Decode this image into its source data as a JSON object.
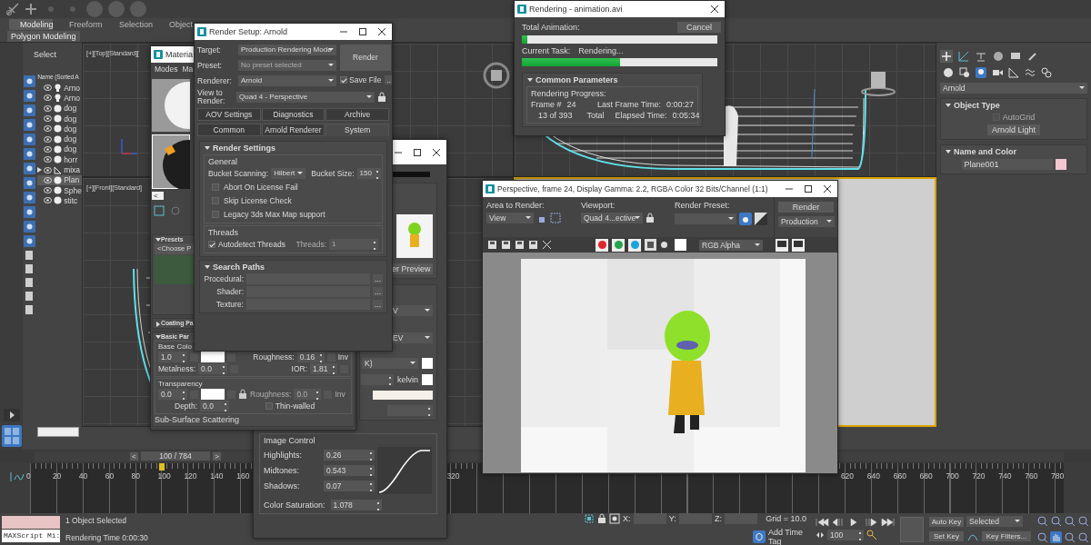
{
  "ribbon": {
    "tabs": [
      {
        "label": "Modeling",
        "selected": true
      },
      {
        "label": "Freeform",
        "selected": false
      },
      {
        "label": "Selection",
        "selected": false
      },
      {
        "label": "Object",
        "selected": false
      }
    ],
    "panel_label": "Polygon Modeling"
  },
  "scene_explorer": {
    "title": "Select",
    "column": "Name (Sorted A",
    "items": [
      {
        "name": "Arno",
        "kind": "light",
        "selected": false,
        "expandable": false
      },
      {
        "name": "Arno",
        "kind": "light",
        "selected": false,
        "expandable": false
      },
      {
        "name": "dog",
        "kind": "geometry",
        "selected": false,
        "expandable": false
      },
      {
        "name": "dog",
        "kind": "geometry",
        "selected": false,
        "expandable": false
      },
      {
        "name": "dog",
        "kind": "geometry",
        "selected": false,
        "expandable": false
      },
      {
        "name": "dog",
        "kind": "geometry",
        "selected": false,
        "expandable": false
      },
      {
        "name": "dog",
        "kind": "geometry",
        "selected": false,
        "expandable": false
      },
      {
        "name": "horr",
        "kind": "geometry",
        "selected": false,
        "expandable": false
      },
      {
        "name": "mixa",
        "kind": "bone",
        "selected": false,
        "expandable": true
      },
      {
        "name": "Plan",
        "kind": "geometry",
        "selected": true,
        "expandable": false
      },
      {
        "name": "Sphe",
        "kind": "geometry",
        "selected": false,
        "expandable": false
      },
      {
        "name": "stitc",
        "kind": "geometry",
        "selected": false,
        "expandable": false
      }
    ]
  },
  "viewports": [
    {
      "label": "[+][Top][Standard][",
      "kind": "grid"
    },
    {
      "kind": "perspective"
    },
    {
      "label": "[+][Front][Standard]",
      "kind": "front"
    },
    {
      "kind": "left"
    }
  ],
  "material_editor": {
    "title": "Materia",
    "menu": [
      "Modes",
      "Ma"
    ],
    "scroll_left": "<",
    "presets": {
      "title": "Presets",
      "dropdown": "<Choose P"
    },
    "coating": {
      "title": "Coating Pa",
      "expanded": false
    },
    "basic": {
      "title": "Basic Par",
      "expanded": true,
      "base_color": "Base Colo",
      "weight": "1.0",
      "roughness_label": "Roughness:",
      "roughness": "0.16",
      "inv": "Inv",
      "metalness_label": "Metalness:",
      "metalness": "0.0",
      "ior_label": "IOR:",
      "ior": "1.81",
      "transparency": "Transparency",
      "transp_weight": "0.0",
      "transp_roughness_label": "Roughness:",
      "transp_roughness": "0.0",
      "transp_inv": "Inv",
      "depth_label": "Depth:",
      "depth": "0.0",
      "thin_walled": {
        "label": "Thin-walled",
        "checked": false
      }
    },
    "sss": "Sub-Surface Scattering"
  },
  "exposure_window": {
    "preview_button": "er Preview",
    "dropdown_1": "V",
    "dropdown_2": "EV",
    "dropdown_3": "K)",
    "kelvin": "kelvin",
    "image_control": {
      "title": "Image Control",
      "rows": [
        {
          "label": "Highlights:",
          "value": "0.26"
        },
        {
          "label": "Midtones:",
          "value": "0.543"
        },
        {
          "label": "Shadows:",
          "value": "0.07"
        }
      ],
      "saturation_label": "Color Saturation:",
      "saturation": "1.078"
    }
  },
  "render_setup": {
    "title": "Render Setup: Arnold",
    "target_label": "Target:",
    "target": "Production Rendering Mode",
    "preset_label": "Preset:",
    "preset": "No preset selected",
    "preset_disabled": true,
    "renderer_label": "Renderer:",
    "renderer": "Arnold",
    "save_file": {
      "label": "Save File",
      "checked": true
    },
    "more": "...",
    "view_label": "View to Render:",
    "view": "Quad 4 - Perspective",
    "render_button": "Render",
    "tab_rows": [
      [
        {
          "label": "AOV Settings",
          "selected": false
        },
        {
          "label": "Diagnostics",
          "selected": false
        },
        {
          "label": "Archive",
          "selected": false
        }
      ],
      [
        {
          "label": "Common",
          "selected": false
        },
        {
          "label": "Arnold Renderer",
          "selected": false
        },
        {
          "label": "System",
          "selected": true
        }
      ]
    ],
    "render_settings": {
      "title": "Render Settings",
      "general": "General",
      "bucket_scanning_label": "Bucket Scanning:",
      "bucket_scanning": "Hilbert",
      "bucket_size_label": "Bucket Size:",
      "bucket_size": "150",
      "options": [
        {
          "label": "Abort On License Fail",
          "checked": false
        },
        {
          "label": "Skip License Check",
          "checked": false
        },
        {
          "label": "Legacy 3ds Max Map support",
          "checked": false
        }
      ],
      "threads": "Threads",
      "autodetect": {
        "label": "Autodetect Threads",
        "checked": true
      },
      "threads_label": "Threads:",
      "threads_value": "1",
      "threads_disabled": true
    },
    "search_paths": {
      "title": "Search Paths",
      "rows": [
        {
          "label": "Procedural:",
          "button": "..."
        },
        {
          "label": "Shader:",
          "button": "..."
        },
        {
          "label": "Texture:",
          "button": "..."
        }
      ]
    }
  },
  "rendering_dialog": {
    "title": "Rendering - animation.avi",
    "cancel": "Cancel",
    "total": {
      "label": "Total Animation:",
      "level": 0.03
    },
    "task": {
      "label": "Current Task:",
      "text": "Rendering...",
      "level": 0.5
    },
    "params_title": "Common Parameters",
    "progress_label": "Rendering Progress:",
    "frame_label": "Frame #",
    "frame": "24",
    "count": "13 of 393",
    "total_text": "Total",
    "last_frame_label": "Last Frame Time:",
    "last_frame": "0:00:27",
    "elapsed_label": "Elapsed Time:",
    "elapsed": "0:05:34"
  },
  "command_panel": {
    "dropdown": "Arnold",
    "object_type": {
      "title": "Object Type",
      "autogrid": {
        "label": "AutoGrid",
        "checked": false,
        "disabled": true
      },
      "button": "Arnold Light"
    },
    "name_color": {
      "title": "Name and Color",
      "name": "Plane001"
    }
  },
  "frame_buffer": {
    "title": "Perspective, frame 24, Display Gamma: 2.2, RGBA Color 32 Bits/Channel (1:1)",
    "area_label": "Area to Render:",
    "area": "View",
    "viewport_label": "Viewport:",
    "viewport": "Quad 4...ective",
    "preset_label": "Render Preset:",
    "render_button": "Render",
    "mode": "Production",
    "channels": [
      {
        "color": "#e0262b",
        "on": true
      },
      {
        "color": "#23a64a",
        "on": true
      },
      {
        "color": "#1aa3e0",
        "on": true
      }
    ],
    "display": "RGB Alpha"
  },
  "timeline": {
    "slider": "100 / 784",
    "level": 0.128,
    "prev": "<",
    "next": ">",
    "ticks": [
      "0",
      "20",
      "40",
      "60",
      "80",
      "100",
      "120",
      "140",
      "160",
      "320",
      "620",
      "640",
      "660",
      "680",
      "700",
      "720",
      "740",
      "760",
      "780"
    ]
  },
  "status": {
    "listener": "MAXScript Mi:",
    "selection": "1 Object Selected",
    "render_time": "Rendering Time  0:00:30",
    "x_label": "X:",
    "y_label": "Y:",
    "z_label": "Z:",
    "grid": "Grid = 10.0",
    "time_tag": "Add Time Tag",
    "frame": "100",
    "auto_key": "Auto Key",
    "key_mode": "Selected",
    "set_key": "Set Key",
    "key_filters": "Key Filters..."
  }
}
